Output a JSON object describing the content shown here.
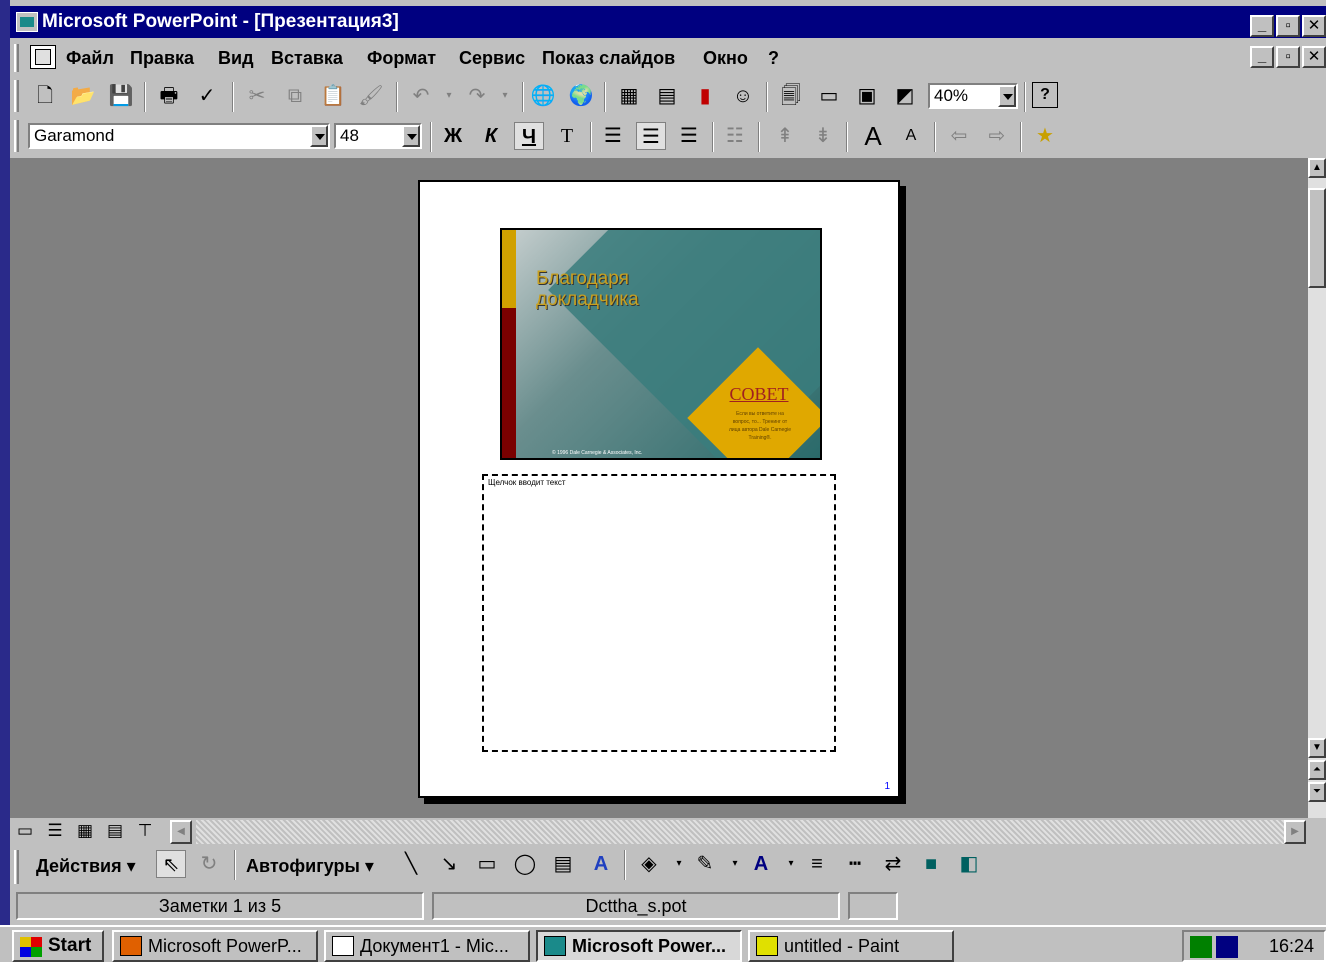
{
  "window": {
    "title": "Microsoft PowerPoint - [Презентация3]"
  },
  "menu": [
    {
      "label": "Файл"
    },
    {
      "label": "Правка"
    },
    {
      "label": "Вид"
    },
    {
      "label": "Вставка"
    },
    {
      "label": "Формат"
    },
    {
      "label": "Сервис"
    },
    {
      "label": "Показ слайдов"
    },
    {
      "label": "Окно"
    },
    {
      "label": "?"
    }
  ],
  "toolbar": {
    "zoom": "40%"
  },
  "formatting": {
    "font": "Garamond",
    "size": "48",
    "bold": "Ж",
    "italic": "К",
    "underline": "Ч",
    "shadow": "Т"
  },
  "slide": {
    "title": "Благодаря докладчика",
    "diamond_title": "СОВЕТ",
    "diamond_text": "Если вы ответите на вопрос, то... Тренинг от лица автора Dale Carnegie Training®.",
    "copyright": "© 1996 Dale Carnegie & Associates, Inc."
  },
  "notes": {
    "placeholder": "Щелчок вводит текст"
  },
  "page_number": "1",
  "drawing": {
    "actions": "Действия",
    "autoshapes": "Автофигуры"
  },
  "status": {
    "notes_page": "Заметки 1 из 5",
    "template": "Dcttha_s.pot"
  },
  "taskbar": {
    "start": "Start",
    "tasks": [
      {
        "label": "Microsoft PowerP..."
      },
      {
        "label": "Документ1 - Mic..."
      },
      {
        "label": "Microsoft Power..."
      },
      {
        "label": "untitled - Paint"
      }
    ],
    "clock": "16:24"
  }
}
